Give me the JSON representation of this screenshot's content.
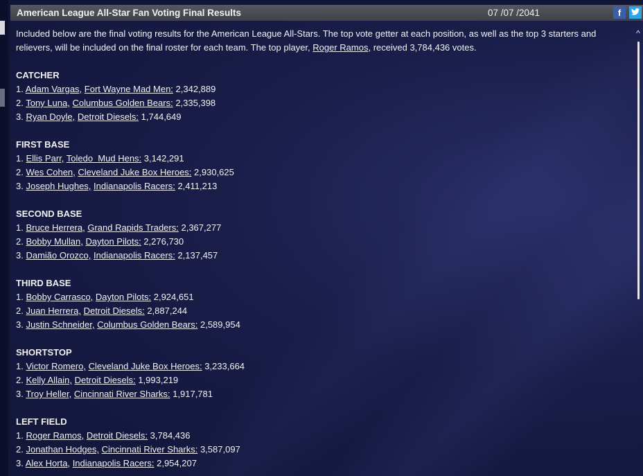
{
  "window": {
    "title": "American League All-Star Fan Voting Final Results",
    "date": "07 /07 /2041",
    "share": {
      "facebook_glyph": "f",
      "twitter_glyph": "❧"
    }
  },
  "intro": {
    "text_before_link": "Included below are the final voting results for the American League All-Stars.  The top vote getter at each position, as well as the top 3 starters and relievers, will be included on the final roster for each team. The top player, ",
    "top_player": "Roger Ramos,",
    "text_after_link": " received 3,784,436 votes."
  },
  "sections": [
    {
      "heading": "CATCHER",
      "entries": [
        {
          "rank": "1. ",
          "player": "Adam Vargas,",
          "team": "Fort Wayne Mad Men:",
          "votes": " 2,342,889"
        },
        {
          "rank": "2. ",
          "player": "Tony Luna,",
          "team": "Columbus Golden Bears:",
          "votes": " 2,335,398"
        },
        {
          "rank": "3. ",
          "player": "Ryan Doyle,",
          "team": "Detroit Diesels:",
          "votes": " 1,744,649"
        }
      ]
    },
    {
      "heading": "FIRST BASE",
      "entries": [
        {
          "rank": "1. ",
          "player": "Ellis Parr,",
          "team": "Toledo  Mud Hens:",
          "votes": " 3,142,291"
        },
        {
          "rank": "2. ",
          "player": "Wes Cohen,",
          "team": "Cleveland Juke Box Heroes:",
          "votes": " 2,930,625"
        },
        {
          "rank": "3. ",
          "player": "Joseph Hughes,",
          "team": "Indianapolis Racers:",
          "votes": " 2,411,213"
        }
      ]
    },
    {
      "heading": "SECOND BASE",
      "entries": [
        {
          "rank": "1. ",
          "player": "Bruce Herrera,",
          "team": "Grand Rapids Traders:",
          "votes": " 2,367,277"
        },
        {
          "rank": "2. ",
          "player": "Bobby Mullan,",
          "team": "Dayton Pilots:",
          "votes": " 2,276,730"
        },
        {
          "rank": "3. ",
          "player": "Damião Orozco,",
          "team": "Indianapolis Racers:",
          "votes": " 2,137,457"
        }
      ]
    },
    {
      "heading": "THIRD BASE",
      "entries": [
        {
          "rank": "1. ",
          "player": "Bobby Carrasco,",
          "team": "Dayton Pilots:",
          "votes": " 2,924,651"
        },
        {
          "rank": "2. ",
          "player": "Juan Herrera,",
          "team": "Detroit Diesels:",
          "votes": " 2,887,244"
        },
        {
          "rank": "3. ",
          "player": "Justin Schneider,",
          "team": "Columbus Golden Bears:",
          "votes": " 2,589,954"
        }
      ]
    },
    {
      "heading": "SHORTSTOP",
      "entries": [
        {
          "rank": "1. ",
          "player": "Victor Romero,",
          "team": "Cleveland Juke Box Heroes:",
          "votes": " 3,233,664"
        },
        {
          "rank": "2. ",
          "player": "Kelly Allain,",
          "team": "Detroit Diesels:",
          "votes": " 1,993,219"
        },
        {
          "rank": "3. ",
          "player": "Troy Heller,",
          "team": "Cincinnati River Sharks:",
          "votes": " 1,917,781"
        }
      ]
    },
    {
      "heading": "LEFT FIELD",
      "entries": [
        {
          "rank": "1. ",
          "player": "Roger Ramos,",
          "team": "Detroit Diesels:",
          "votes": " 3,784,436"
        },
        {
          "rank": "2. ",
          "player": "Jonathan Hodges,",
          "team": "Cincinnati River Sharks:",
          "votes": " 3,587,097"
        },
        {
          "rank": "3. ",
          "player": "Alex Horta,",
          "team": "Indianapolis Racers:",
          "votes": " 2,954,207"
        }
      ]
    }
  ],
  "scrollbar": {
    "up_glyph": "^"
  },
  "colors": {
    "background": "#12163a",
    "titlebar": "#4a4b53",
    "text": "#f2f2f5",
    "facebook": "#3b5ea8",
    "twitter": "#2ea6e6"
  }
}
